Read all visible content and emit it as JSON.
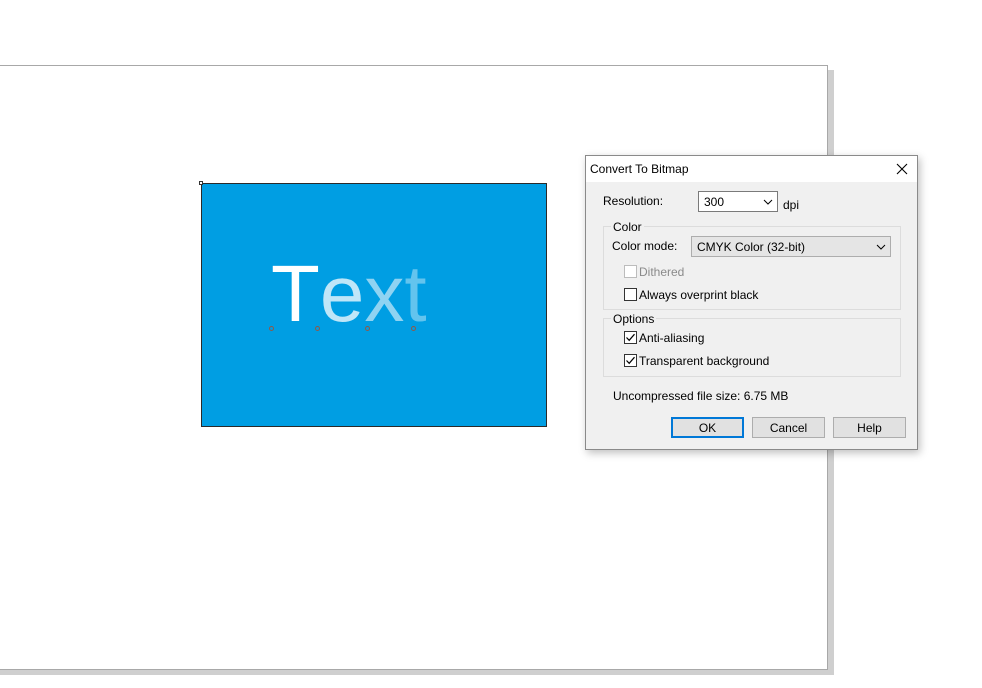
{
  "canvas": {
    "artwork_text": "Text",
    "rectangle_color": "#009ee3",
    "text_gradient": [
      "#ffffff",
      "#bfe6f8",
      "#8fd3f2",
      "#63c4ee"
    ]
  },
  "dialog": {
    "title": "Convert To Bitmap",
    "resolution": {
      "label": "Resolution:",
      "value": "300",
      "unit": "dpi"
    },
    "color_group": {
      "title": "Color",
      "color_mode_label": "Color mode:",
      "color_mode_value": "CMYK Color (32-bit)",
      "dithered": {
        "label": "Dithered",
        "checked": false,
        "enabled": false
      },
      "overprint": {
        "label": "Always overprint black",
        "checked": false
      }
    },
    "options_group": {
      "title": "Options",
      "anti_aliasing": {
        "label": "Anti-aliasing",
        "checked": true
      },
      "transparent_bg": {
        "label": "Transparent background",
        "checked": true
      }
    },
    "file_size": "Uncompressed file size: 6.75 MB",
    "buttons": {
      "ok": "OK",
      "cancel": "Cancel",
      "help": "Help"
    }
  }
}
